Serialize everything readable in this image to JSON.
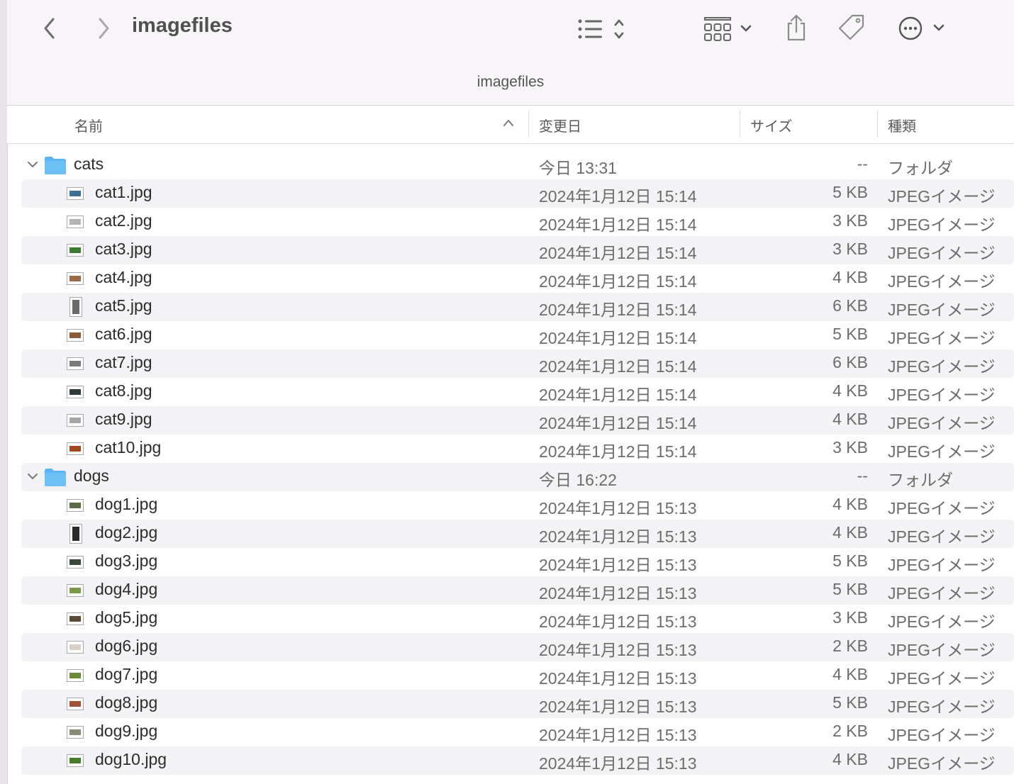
{
  "window": {
    "title": "imagefiles",
    "path_title": "imagefiles"
  },
  "toolbar": {
    "back_icon": "chevron-left-icon",
    "forward_icon": "chevron-right-icon",
    "view_icon": "list-view-icon",
    "group_icon": "grid-group-icon",
    "share_icon": "share-icon",
    "tag_icon": "tag-icon",
    "more_icon": "ellipsis-circle-icon"
  },
  "columns": {
    "name": "名前",
    "date": "変更日",
    "size": "サイズ",
    "kind": "種類"
  },
  "colors": {
    "folder": "#5ab4f0",
    "row_alt": "#f3f3f5",
    "toolbar_bg": "#f8f5f8"
  },
  "rows": [
    {
      "type": "folder",
      "name": "cats",
      "date": "今日 13:31",
      "size": "--",
      "kind": "フォルダ"
    },
    {
      "type": "file",
      "name": "cat1.jpg",
      "date": "2024年1月12日 15:14",
      "size": "5 KB",
      "kind": "JPEGイメージ",
      "thumb": "#3e6f92"
    },
    {
      "type": "file",
      "name": "cat2.jpg",
      "date": "2024年1月12日 15:14",
      "size": "3 KB",
      "kind": "JPEGイメージ",
      "thumb": "#b4b4b4"
    },
    {
      "type": "file",
      "name": "cat3.jpg",
      "date": "2024年1月12日 15:14",
      "size": "3 KB",
      "kind": "JPEGイメージ",
      "thumb": "#3e7a35"
    },
    {
      "type": "file",
      "name": "cat4.jpg",
      "date": "2024年1月12日 15:14",
      "size": "4 KB",
      "kind": "JPEGイメージ",
      "thumb": "#9a6a4a"
    },
    {
      "type": "file",
      "name": "cat5.jpg",
      "date": "2024年1月12日 15:14",
      "size": "6 KB",
      "kind": "JPEGイメージ",
      "thumb": "#6a6a6a",
      "tall": true
    },
    {
      "type": "file",
      "name": "cat6.jpg",
      "date": "2024年1月12日 15:14",
      "size": "5 KB",
      "kind": "JPEGイメージ",
      "thumb": "#8a5a3a"
    },
    {
      "type": "file",
      "name": "cat7.jpg",
      "date": "2024年1月12日 15:14",
      "size": "6 KB",
      "kind": "JPEGイメージ",
      "thumb": "#7a7a7a"
    },
    {
      "type": "file",
      "name": "cat8.jpg",
      "date": "2024年1月12日 15:14",
      "size": "4 KB",
      "kind": "JPEGイメージ",
      "thumb": "#2d3a3a"
    },
    {
      "type": "file",
      "name": "cat9.jpg",
      "date": "2024年1月12日 15:14",
      "size": "4 KB",
      "kind": "JPEGイメージ",
      "thumb": "#a6a6a6"
    },
    {
      "type": "file",
      "name": "cat10.jpg",
      "date": "2024年1月12日 15:14",
      "size": "3 KB",
      "kind": "JPEGイメージ",
      "thumb": "#a04a22"
    },
    {
      "type": "folder",
      "name": "dogs",
      "date": "今日 16:22",
      "size": "--",
      "kind": "フォルダ"
    },
    {
      "type": "file",
      "name": "dog1.jpg",
      "date": "2024年1月12日 15:13",
      "size": "4 KB",
      "kind": "JPEGイメージ",
      "thumb": "#5a6a4a"
    },
    {
      "type": "file",
      "name": "dog2.jpg",
      "date": "2024年1月12日 15:13",
      "size": "4 KB",
      "kind": "JPEGイメージ",
      "thumb": "#2a2a2a",
      "tall": true
    },
    {
      "type": "file",
      "name": "dog3.jpg",
      "date": "2024年1月12日 15:13",
      "size": "5 KB",
      "kind": "JPEGイメージ",
      "thumb": "#3a4a3a"
    },
    {
      "type": "file",
      "name": "dog4.jpg",
      "date": "2024年1月12日 15:13",
      "size": "5 KB",
      "kind": "JPEGイメージ",
      "thumb": "#7a9a4a"
    },
    {
      "type": "file",
      "name": "dog5.jpg",
      "date": "2024年1月12日 15:13",
      "size": "3 KB",
      "kind": "JPEGイメージ",
      "thumb": "#5a4a3a"
    },
    {
      "type": "file",
      "name": "dog6.jpg",
      "date": "2024年1月12日 15:13",
      "size": "2 KB",
      "kind": "JPEGイメージ",
      "thumb": "#d8d0c8"
    },
    {
      "type": "file",
      "name": "dog7.jpg",
      "date": "2024年1月12日 15:13",
      "size": "4 KB",
      "kind": "JPEGイメージ",
      "thumb": "#6a8a3a"
    },
    {
      "type": "file",
      "name": "dog8.jpg",
      "date": "2024年1月12日 15:13",
      "size": "5 KB",
      "kind": "JPEGイメージ",
      "thumb": "#a0503a"
    },
    {
      "type": "file",
      "name": "dog9.jpg",
      "date": "2024年1月12日 15:13",
      "size": "2 KB",
      "kind": "JPEGイメージ",
      "thumb": "#8a8a7a"
    },
    {
      "type": "file",
      "name": "dog10.jpg",
      "date": "2024年1月12日 15:13",
      "size": "4 KB",
      "kind": "JPEGイメージ",
      "thumb": "#4a7a2a"
    }
  ]
}
